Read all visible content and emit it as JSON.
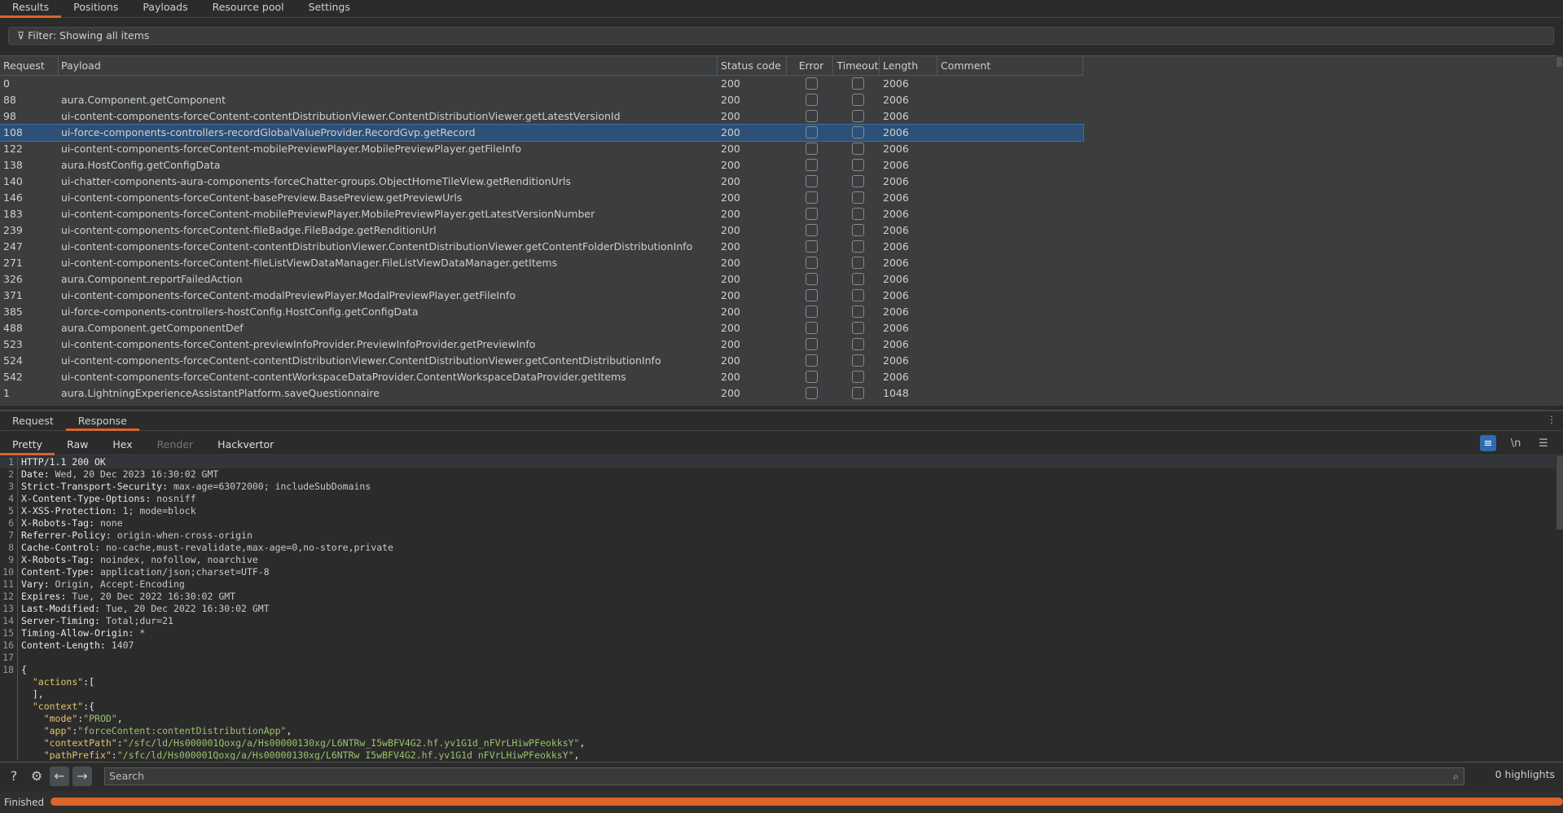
{
  "top_tabs": [
    "Results",
    "Positions",
    "Payloads",
    "Resource pool",
    "Settings"
  ],
  "filter": {
    "label": "Filter: Showing all items"
  },
  "table": {
    "columns": [
      "Request",
      "Payload",
      "Status code",
      "Error",
      "Timeout",
      "Length",
      "Comment"
    ],
    "sorted_column": "Length",
    "selected_request": "108",
    "rows": [
      [
        "0",
        "",
        "200",
        "2006"
      ],
      [
        "88",
        "aura.Component.getComponent",
        "200",
        "2006"
      ],
      [
        "98",
        "ui-content-components-forceContent-contentDistributionViewer.ContentDistributionViewer.getLatestVersionId",
        "200",
        "2006"
      ],
      [
        "108",
        "ui-force-components-controllers-recordGlobalValueProvider.RecordGvp.getRecord",
        "200",
        "2006"
      ],
      [
        "122",
        "ui-content-components-forceContent-mobilePreviewPlayer.MobilePreviewPlayer.getFileInfo",
        "200",
        "2006"
      ],
      [
        "138",
        "aura.HostConfig.getConfigData",
        "200",
        "2006"
      ],
      [
        "140",
        "ui-chatter-components-aura-components-forceChatter-groups.ObjectHomeTileView.getRenditionUrls",
        "200",
        "2006"
      ],
      [
        "146",
        "ui-content-components-forceContent-basePreview.BasePreview.getPreviewUrls",
        "200",
        "2006"
      ],
      [
        "183",
        "ui-content-components-forceContent-mobilePreviewPlayer.MobilePreviewPlayer.getLatestVersionNumber",
        "200",
        "2006"
      ],
      [
        "239",
        "ui-content-components-forceContent-fileBadge.FileBadge.getRenditionUrl",
        "200",
        "2006"
      ],
      [
        "247",
        "ui-content-components-forceContent-contentDistributionViewer.ContentDistributionViewer.getContentFolderDistributionInfo",
        "200",
        "2006"
      ],
      [
        "271",
        "ui-content-components-forceContent-fileListViewDataManager.FileListViewDataManager.getItems",
        "200",
        "2006"
      ],
      [
        "326",
        "aura.Component.reportFailedAction",
        "200",
        "2006"
      ],
      [
        "371",
        "ui-content-components-forceContent-modalPreviewPlayer.ModalPreviewPlayer.getFileInfo",
        "200",
        "2006"
      ],
      [
        "385",
        "ui-force-components-controllers-hostConfig.HostConfig.getConfigData",
        "200",
        "2006"
      ],
      [
        "488",
        "aura.Component.getComponentDef",
        "200",
        "2006"
      ],
      [
        "523",
        "ui-content-components-forceContent-previewInfoProvider.PreviewInfoProvider.getPreviewInfo",
        "200",
        "2006"
      ],
      [
        "524",
        "ui-content-components-forceContent-contentDistributionViewer.ContentDistributionViewer.getContentDistributionInfo",
        "200",
        "2006"
      ],
      [
        "542",
        "ui-content-components-forceContent-contentWorkspaceDataProvider.ContentWorkspaceDataProvider.getItems",
        "200",
        "2006"
      ],
      [
        "1",
        "aura.LightningExperienceAssistantPlatform.saveQuestionnaire",
        "200",
        "1048"
      ]
    ]
  },
  "message_tabs": [
    "Request",
    "Response"
  ],
  "active_message_tab": "Response",
  "view_tabs": [
    "Pretty",
    "Raw",
    "Hex",
    "Render",
    "Hackvertor"
  ],
  "active_view_tab": "Pretty",
  "toolbar_icons": [
    "word-wrap-icon",
    "newline-icon",
    "menu-icon"
  ],
  "newline_label": "\\n",
  "editor_lines": [
    [
      "1",
      "HTTP/1.1 200 OK"
    ],
    [
      "2",
      "Date: Wed, 20 Dec 2023 16:30:02 GMT"
    ],
    [
      "3",
      "Strict-Transport-Security: max-age=63072000; includeSubDomains"
    ],
    [
      "4",
      "X-Content-Type-Options: nosniff"
    ],
    [
      "5",
      "X-XSS-Protection: 1; mode=block"
    ],
    [
      "6",
      "X-Robots-Tag: none"
    ],
    [
      "7",
      "Referrer-Policy: origin-when-cross-origin"
    ],
    [
      "8",
      "Cache-Control: no-cache,must-revalidate,max-age=0,no-store,private"
    ],
    [
      "9",
      "X-Robots-Tag: noindex, nofollow, noarchive"
    ],
    [
      "10",
      "Content-Type: application/json;charset=UTF-8"
    ],
    [
      "11",
      "Vary: Origin, Accept-Encoding"
    ],
    [
      "12",
      "Expires: Tue, 20 Dec 2022 16:30:02 GMT"
    ],
    [
      "13",
      "Last-Modified: Tue, 20 Dec 2022 16:30:02 GMT"
    ],
    [
      "14",
      "Server-Timing: Total;dur=21"
    ],
    [
      "15",
      "Timing-Allow-Origin: *"
    ],
    [
      "16",
      "Content-Length: 1407"
    ],
    [
      "17",
      ""
    ],
    [
      "18",
      "{"
    ]
  ],
  "json_lines": [
    {
      "indent": "  ",
      "key": "\"actions\"",
      "rest": ":["
    },
    {
      "indent": "  ",
      "key": "",
      "rest": "],"
    },
    {
      "indent": "  ",
      "key": "\"context\"",
      "rest": ":{"
    },
    {
      "indent": "    ",
      "key": "\"mode\"",
      "val": "\"PROD\"",
      "rest": ","
    },
    {
      "indent": "    ",
      "key": "\"app\"",
      "val": "\"forceContent:contentDistributionApp\"",
      "rest": ","
    },
    {
      "indent": "    ",
      "key": "\"contextPath\"",
      "val": "\"/sfc/ld/Hs000001Qoxg/a/Hs00000130xg/L6NTRw_I5wBFV4G2.hf.yv1G1d_nFVrLHiwPFeokksY\"",
      "rest": ","
    },
    {
      "indent": "    ",
      "key": "\"pathPrefix\"",
      "val": "\"/sfc/ld/Hs000001Qoxg/a/Hs00000130xg/L6NTRw_I5wBFV4G2.hf.yv1G1d_nFVrLHiwPFeokksY\"",
      "rest": ","
    }
  ],
  "search": {
    "placeholder": "Search",
    "highlights": "0 highlights"
  },
  "status": {
    "label": "Finished",
    "progress_percent": 100
  },
  "colors": {
    "accent": "#d9652b",
    "selection": "#2d5078",
    "json_key": "#e3c46b",
    "json_string": "#9cc26b"
  }
}
